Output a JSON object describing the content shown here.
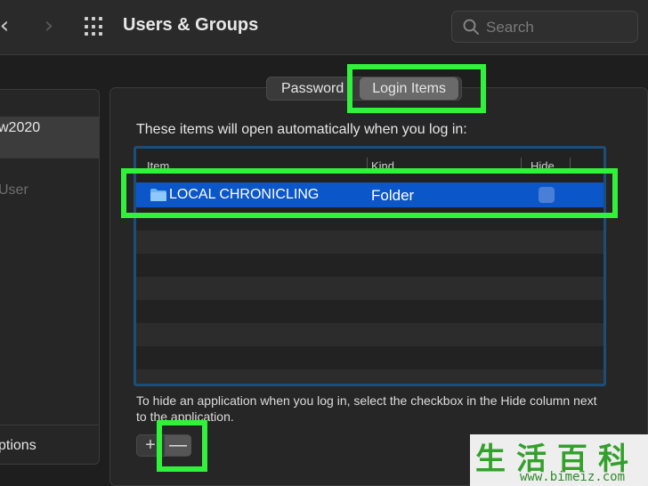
{
  "toolbar": {
    "back_glyph": "‹",
    "forward_glyph": "›",
    "title": "Users & Groups",
    "search_placeholder": "Search",
    "icons": [
      "chevron-left-icon",
      "chevron-right-icon",
      "grid-icon",
      "search-icon"
    ]
  },
  "sidebar": {
    "selected_user": "w2020",
    "other_user": "User",
    "options_label": "ptions"
  },
  "tabs": [
    {
      "label": "Password",
      "active": false
    },
    {
      "label": "Login Items",
      "active": true
    }
  ],
  "main": {
    "intro": "These items will open automatically when you log in:",
    "columns": [
      "Item",
      "Kind",
      "Hide"
    ],
    "rows": [
      {
        "name": "LOCAL CHRONICLING",
        "kind": "Folder",
        "hide": false,
        "selected": true
      }
    ],
    "hint": "To hide an application when you log in, select the checkbox in the Hide column next to the application.",
    "add_label": "+",
    "remove_label": "—"
  },
  "watermark": {
    "chinese": "生活百科",
    "url": "www.bimeiz.com"
  },
  "colors": {
    "highlight": "#31f23a",
    "selection": "#0b56c8",
    "table_border": "#1d4e78"
  }
}
